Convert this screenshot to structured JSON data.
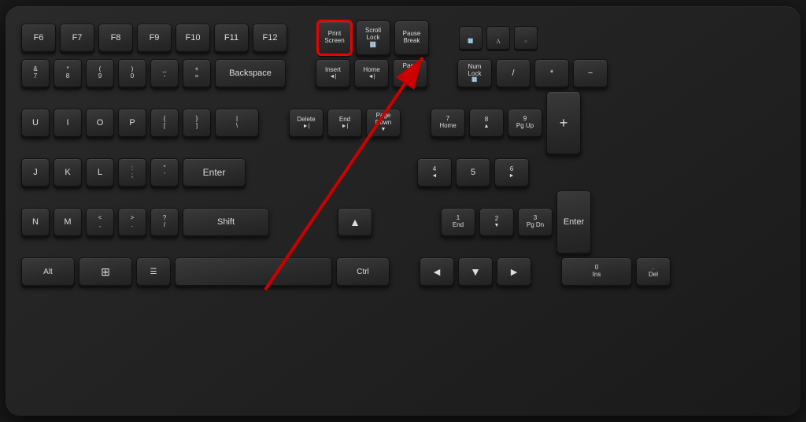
{
  "keyboard": {
    "title": "Keyboard with Print Screen highlighted",
    "background_color": "#1e1e1e",
    "highlight_color": "#cc0000",
    "rows": {
      "fn_row": [
        "F6",
        "F7",
        "F8",
        "F9",
        "F10",
        "F11",
        "F12"
      ],
      "special_keys": [
        "Print Screen",
        "Scroll Lock",
        "Pause Break"
      ],
      "num_row": [
        "&",
        "*",
        "(",
        ")",
        "-",
        "+",
        "Backspace"
      ],
      "num_row_sub": [
        "7",
        "8",
        "9",
        "0",
        "-",
        "=",
        ""
      ],
      "qwerty_row": [
        "U",
        "I",
        "O",
        "P",
        "{[",
        "}]",
        "\\|"
      ],
      "asdf_row": [
        "J",
        "K",
        "L",
        ":;",
        "\"'",
        "Enter"
      ],
      "zxcv_row": [
        "N",
        "M",
        "<,",
        ">.",
        "?/",
        "Shift"
      ],
      "bottom_row": [
        "Alt",
        "Win",
        "Menu",
        "Ctrl"
      ]
    },
    "numpad": {
      "top_row": [
        "Num Lock",
        "/",
        " * ",
        ""
      ],
      "row2": [
        "7",
        "8",
        "9",
        "+"
      ],
      "row3": [
        "4",
        "5",
        "6",
        ""
      ],
      "row4": [
        "1",
        "2",
        "3",
        "Enter"
      ],
      "row5": [
        "0",
        "",
        ".",
        ""
      ]
    },
    "nav_cluster": {
      "top": [
        "Insert",
        "Home",
        "Page Up"
      ],
      "mid": [
        "Delete",
        "End",
        "Page Down"
      ],
      "arrows": [
        "",
        "▲",
        "",
        "◄",
        "▼",
        "►"
      ]
    }
  }
}
